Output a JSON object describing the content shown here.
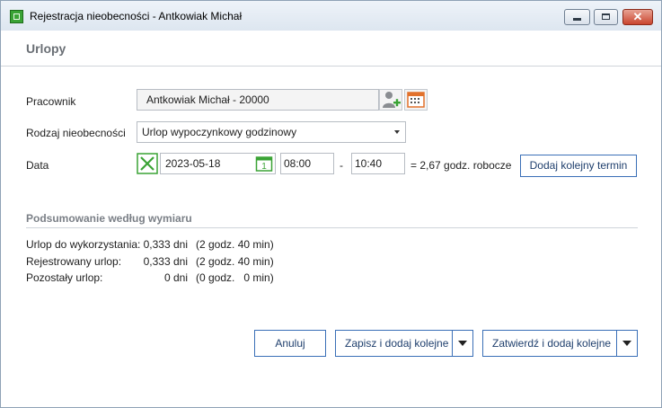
{
  "window": {
    "title": "Rejestracja nieobecności - Antkowiak Michał",
    "close_glyph": "✕"
  },
  "header": {
    "title": "Urlopy"
  },
  "form": {
    "employee_label": "Pracownik",
    "employee_value": "Antkowiak Michał - 20000",
    "absence_type_label": "Rodzaj nieobecności",
    "absence_type_value": "Urlop wypoczynkowy godzinowy",
    "date_label": "Data",
    "date_value": "2023-05-18",
    "calendar_day": "1",
    "time_from": "08:00",
    "time_separator": "-",
    "time_to": "10:40",
    "duration_text": "= 2,67 godz. robocze",
    "add_term_label": "Dodaj kolejny termin"
  },
  "summary": {
    "title": "Podsumowanie według wymiaru",
    "rows": [
      {
        "label": "Urlop do wykorzystania:",
        "days": "0,333 dni",
        "hours": "(2 godz. 40 min)"
      },
      {
        "label": "Rejestrowany urlop:",
        "days": "0,333 dni",
        "hours": "(2 godz. 40 min)"
      },
      {
        "label": "Pozostały urlop:",
        "days": "0 dni",
        "hours": "(0 godz.   0 min)"
      }
    ]
  },
  "footer": {
    "cancel_label": "Anuluj",
    "save_add_label": "Zapisz i dodaj kolejne",
    "confirm_add_label": "Zatwierdź i dodaj kolejne"
  },
  "colors": {
    "accent_blue": "#3a6fb7",
    "status_green": "#3aa335",
    "calendar_orange": "#e2712b",
    "close_red": "#c9452e"
  },
  "icons": {
    "app": "app-icon",
    "add_person": "add-person-icon",
    "calendar": "calendar-icon",
    "clear": "clear-x-icon",
    "date_picker": "calendar-day-icon"
  }
}
